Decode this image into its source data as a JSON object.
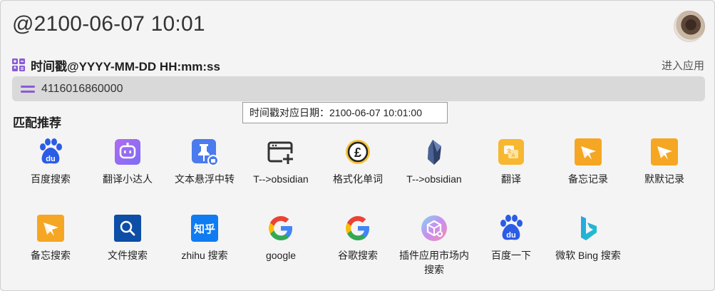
{
  "header": {
    "title": "@2100-06-07 10:01"
  },
  "plugin": {
    "name": "时间戳@YYYY-MM-DD HH:mm:ss",
    "enter_label": "进入应用"
  },
  "input": {
    "value": "4116016860000"
  },
  "tooltip": {
    "text": "时间戳对应日期：2100-06-07 10:01:00"
  },
  "section": {
    "title": "匹配推荐"
  },
  "colors": {
    "accent": "#8a5ad6",
    "background": "#f4f4f4",
    "input_bg": "#d9d9d9"
  },
  "items": [
    {
      "label": "百度搜索",
      "icon": "baidu-icon"
    },
    {
      "label": "翻译小达人",
      "icon": "translate-bot-icon"
    },
    {
      "label": "文本悬浮中转",
      "icon": "pin-icon"
    },
    {
      "label": "T-->obsidian",
      "icon": "window-add-icon"
    },
    {
      "label": "格式化单词",
      "icon": "pound-icon"
    },
    {
      "label": "T-->obsidian",
      "icon": "obsidian-icon"
    },
    {
      "label": "翻译",
      "icon": "translate-icon"
    },
    {
      "label": "备忘记录",
      "icon": "memo-icon"
    },
    {
      "label": "默默记录",
      "icon": "memo-icon"
    },
    {
      "label": "备忘搜索",
      "icon": "memo-icon"
    },
    {
      "label": "文件搜索",
      "icon": "file-search-icon"
    },
    {
      "label": "zhihu 搜索",
      "icon": "zhihu-icon"
    },
    {
      "label": "google",
      "icon": "google-icon"
    },
    {
      "label": "谷歌搜索",
      "icon": "google-icon"
    },
    {
      "label": "插件应用市场内搜索",
      "icon": "plugin-market-icon"
    },
    {
      "label": "百度一下",
      "icon": "baidu-icon"
    },
    {
      "label": "微软 Bing 搜索",
      "icon": "bing-icon"
    }
  ]
}
